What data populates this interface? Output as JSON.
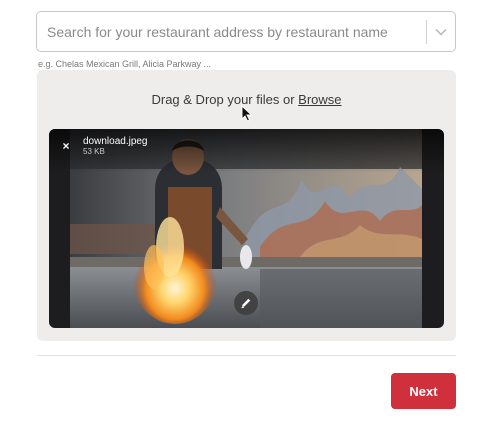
{
  "search": {
    "placeholder": "Search for your restaurant address by restaurant name",
    "value": "",
    "hint": "e.g. Chelas Mexican Grill, Alicia Parkway ..."
  },
  "dropzone": {
    "prompt": "Drag & Drop your files or ",
    "browse_label": "Browse"
  },
  "file": {
    "name": "download.jpeg",
    "size": "53 KB",
    "remove_symbol": "×"
  },
  "footer": {
    "next_label": "Next"
  },
  "colors": {
    "accent": "#d0303c",
    "dropzone_bg": "#eeedeb"
  },
  "icons": {
    "select_toggle": "chevron-down-icon",
    "remove": "close-icon",
    "edit": "pencil-icon"
  }
}
